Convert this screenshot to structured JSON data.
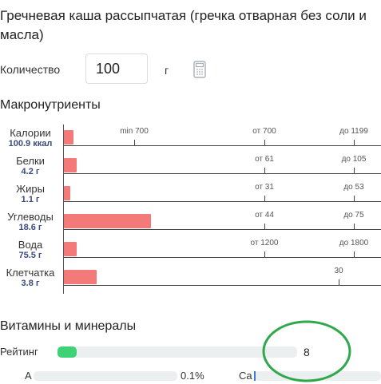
{
  "product": {
    "title": "Гречневая каша рассыпчатая (гречка отварная без соли и масла)"
  },
  "quantity": {
    "label": "Количество",
    "value": "100",
    "unit": "г",
    "calculator_icon": "calculator-icon"
  },
  "macros": {
    "heading": "Макронутриенты",
    "rows": [
      {
        "name": "Калории",
        "value": "100.9 ккал",
        "bar_fraction": 0.029,
        "ticks": [
          {
            "text": "min 700",
            "pos": 0.221
          },
          {
            "text": "от 700",
            "pos": 0.633
          },
          {
            "text": "до 1199",
            "pos": 0.914
          }
        ]
      },
      {
        "name": "Белки",
        "value": "4.2 г",
        "bar_fraction": 0.041,
        "ticks": [
          {
            "text": "от 61",
            "pos": 0.633
          },
          {
            "text": "до 105",
            "pos": 0.914
          }
        ]
      },
      {
        "name": "Жиры",
        "value": "1.1 г",
        "bar_fraction": 0.019,
        "ticks": [
          {
            "text": "от 31",
            "pos": 0.633
          },
          {
            "text": "до 53",
            "pos": 0.914
          }
        ]
      },
      {
        "name": "Углеводы",
        "value": "18.6 г",
        "bar_fraction": 0.275,
        "ticks": [
          {
            "text": "от 44",
            "pos": 0.633
          },
          {
            "text": "до 75",
            "pos": 0.914
          }
        ]
      },
      {
        "name": "Вода",
        "value": "75.5 г",
        "bar_fraction": 0.041,
        "ticks": [
          {
            "text": "от 1200",
            "pos": 0.633
          },
          {
            "text": "до 1800",
            "pos": 0.914
          }
        ]
      },
      {
        "name": "Клетчатка",
        "value": "3.8 г",
        "bar_fraction": 0.103,
        "ticks": [
          {
            "text": "30",
            "pos": 0.866
          }
        ]
      }
    ]
  },
  "vitamins": {
    "heading": "Витамины и минералы",
    "rating": {
      "label": "Рейтинг",
      "value": "8",
      "fraction": 0.08
    },
    "items": [
      {
        "name": "A",
        "value": "0.1%"
      },
      {
        "name": "Ca",
        "value": ""
      }
    ]
  },
  "colors": {
    "bar": "#f47a7a",
    "rating_fill": "#3fd175",
    "value_text": "#3a4a7a",
    "annotation_circle": "#2fa84a"
  }
}
